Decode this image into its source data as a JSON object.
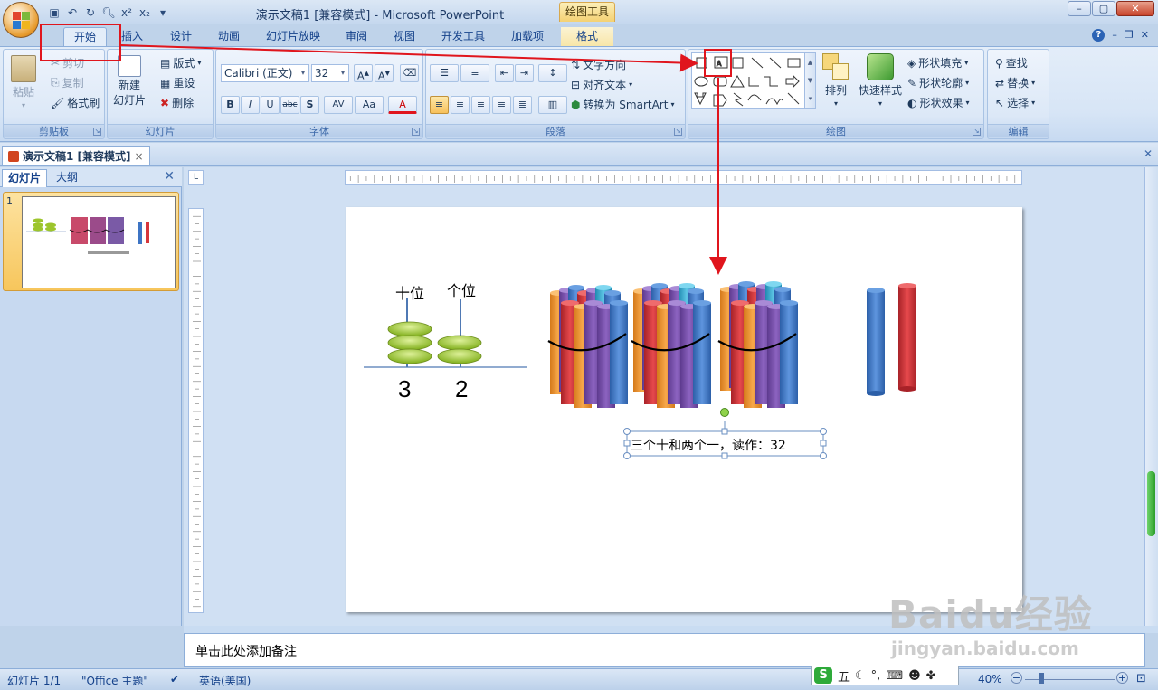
{
  "window": {
    "title": "演示文稿1 [兼容模式] - Microsoft PowerPoint",
    "context_tab_group": "绘图工具",
    "controls": [
      "–",
      "▢",
      "✕"
    ]
  },
  "ribbon_tabs": [
    "开始",
    "插入",
    "设计",
    "动画",
    "幻灯片放映",
    "审阅",
    "视图",
    "开发工具",
    "加载项",
    "格式"
  ],
  "ribbon": {
    "clipboard": {
      "label": "剪贴板",
      "paste": "粘贴",
      "cut": "剪切",
      "copy": "复制",
      "format_painter": "格式刷"
    },
    "slides": {
      "label": "幻灯片",
      "new_slide_l1": "新建",
      "new_slide_l2": "幻灯片",
      "layout": "版式",
      "reset": "重设",
      "delete": "删除"
    },
    "font": {
      "label": "字体",
      "family": "Calibri (正文)",
      "size": "32",
      "bold": "B",
      "italic": "I",
      "underline": "U",
      "strike": "abc",
      "shadow": "S",
      "spacing": "AV",
      "case": "Aa",
      "color": "A"
    },
    "paragraph": {
      "label": "段落",
      "text_direction": "文字方向",
      "align_text": "对齐文本",
      "smartart": "转换为 SmartArt"
    },
    "drawing": {
      "label": "绘图",
      "arrange": "排列",
      "quick_styles": "快速样式",
      "shape_fill": "形状填充",
      "shape_outline": "形状轮廓",
      "shape_effects": "形状效果"
    },
    "editing": {
      "label": "编辑",
      "find": "查找",
      "replace": "替换",
      "select": "选择"
    }
  },
  "document_tab": "演示文稿1 [兼容模式]",
  "slide_pane": {
    "tabs": [
      "幻灯片",
      "大纲"
    ],
    "thumb_number": "1"
  },
  "slide": {
    "tens_label": "十位",
    "ones_label": "个位",
    "tens_digit": "3",
    "ones_digit": "2",
    "textbox": "三个十和两个一，读作：32"
  },
  "notes_placeholder": "单击此处添加备注",
  "status": {
    "slide_count": "幻灯片 1/1",
    "theme": "\"Office 主题\"",
    "language": "英语(美国)",
    "zoom": "40%"
  },
  "ime": {
    "mode": "五"
  },
  "watermark": {
    "brand": "Baidu经验",
    "url": "jingyan.baidu.com"
  },
  "colors": {
    "annotation_red": "#e0151d",
    "bead_green": "#9dc52c",
    "stick_blue": "#3d74c4",
    "stick_red": "#d6363b"
  }
}
